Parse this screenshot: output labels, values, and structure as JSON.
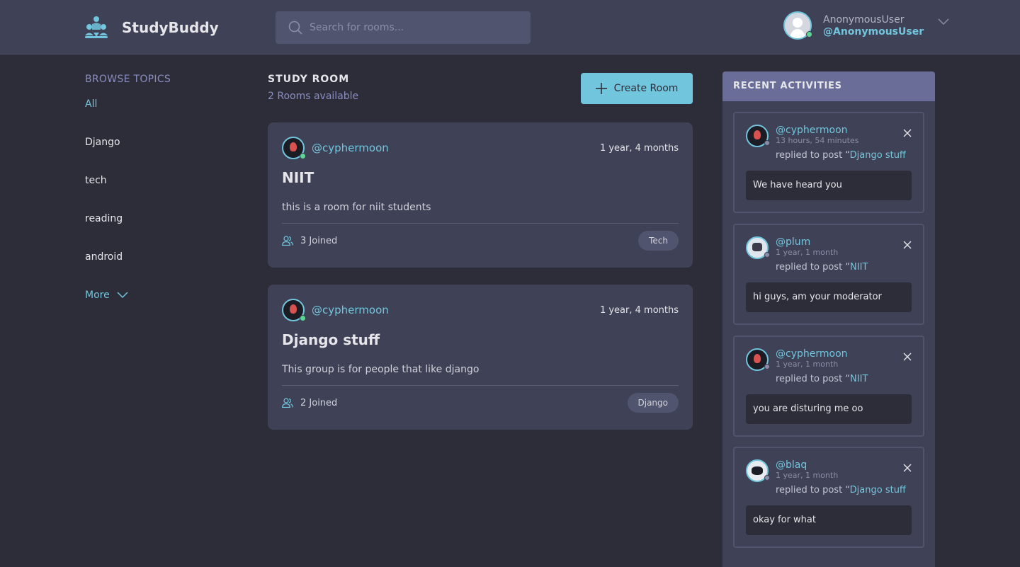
{
  "header": {
    "brand": "StudyBuddy",
    "search_placeholder": "Search for rooms...",
    "user_name": "AnonymousUser",
    "user_handle": "@AnonymousUser"
  },
  "topics": {
    "title": "BROWSE TOPICS",
    "items": [
      "All",
      "Django",
      "tech",
      "reading",
      "android"
    ],
    "more": "More"
  },
  "main": {
    "title": "STUDY ROOM",
    "subtitle": "2 Rooms available",
    "create_label": "Create Room",
    "rooms": [
      {
        "host": "@cyphermoon",
        "time": "1 year, 4 months",
        "name": "NIIT",
        "description": "this is a room for niit students",
        "joined": "3 Joined",
        "topic": "Tech"
      },
      {
        "host": "@cyphermoon",
        "time": "1 year, 4 months",
        "name": "Django stuff",
        "description": "This group is for people that like django",
        "joined": "2 Joined",
        "topic": "Django"
      }
    ]
  },
  "activities": {
    "title": "RECENT ACTIVITIES",
    "items": [
      {
        "user": "@cyphermoon",
        "time": "13 hours, 54 minutes",
        "action": "replied to post “",
        "target": "Django stuff",
        "message": "We have heard you"
      },
      {
        "user": "@plum",
        "time": "1 year, 1 month",
        "action": "replied to post “",
        "target": "NIIT",
        "message": "hi guys, am your moderator"
      },
      {
        "user": "@cyphermoon",
        "time": "1 year, 1 month",
        "action": "replied to post “",
        "target": "NIIT",
        "message": "you are disturing me oo"
      },
      {
        "user": "@blaq",
        "time": "1 year, 1 month",
        "action": "replied to post “",
        "target": "Django stuff",
        "message": "okay for what"
      }
    ]
  },
  "colors": {
    "background": "#2d2d39",
    "panel": "#3f4156",
    "accent": "#71c6dd",
    "activity_header": "#696d97",
    "online": "#5dd693"
  }
}
